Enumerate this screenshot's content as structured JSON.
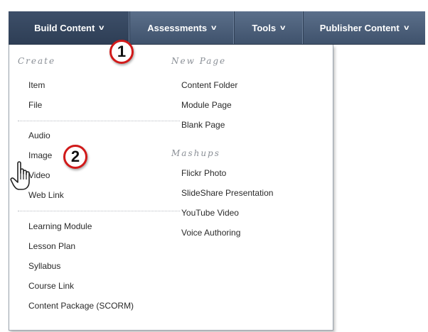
{
  "toolbar": {
    "items": [
      {
        "label": "Build Content",
        "icon": "chevron-down-icon",
        "active": true
      },
      {
        "label": "Assessments",
        "icon": "chevron-down-icon"
      },
      {
        "label": "Tools",
        "icon": "chevron-down-icon"
      },
      {
        "label": "Publisher Content",
        "icon": "chevron-down-icon"
      }
    ],
    "caret": "v"
  },
  "menu": {
    "create": {
      "heading": "Create",
      "group1": [
        "Item",
        "File"
      ],
      "group2": [
        "Audio",
        "Image",
        "Video",
        "Web Link"
      ],
      "group3": [
        "Learning Module",
        "Lesson Plan",
        "Syllabus",
        "Course Link",
        "Content Package (SCORM)"
      ]
    },
    "new_page": {
      "heading": "New Page",
      "items": [
        "Content Folder",
        "Module Page",
        "Blank Page"
      ]
    },
    "mashups": {
      "heading": "Mashups",
      "items": [
        "Flickr Photo",
        "SlideShare Presentation",
        "YouTube Video",
        "Voice Authoring"
      ]
    }
  },
  "callouts": {
    "step1": "1",
    "step2": "2"
  },
  "colors": {
    "toolbar": "#4a5d78",
    "callout_border": "#d11a1a"
  }
}
